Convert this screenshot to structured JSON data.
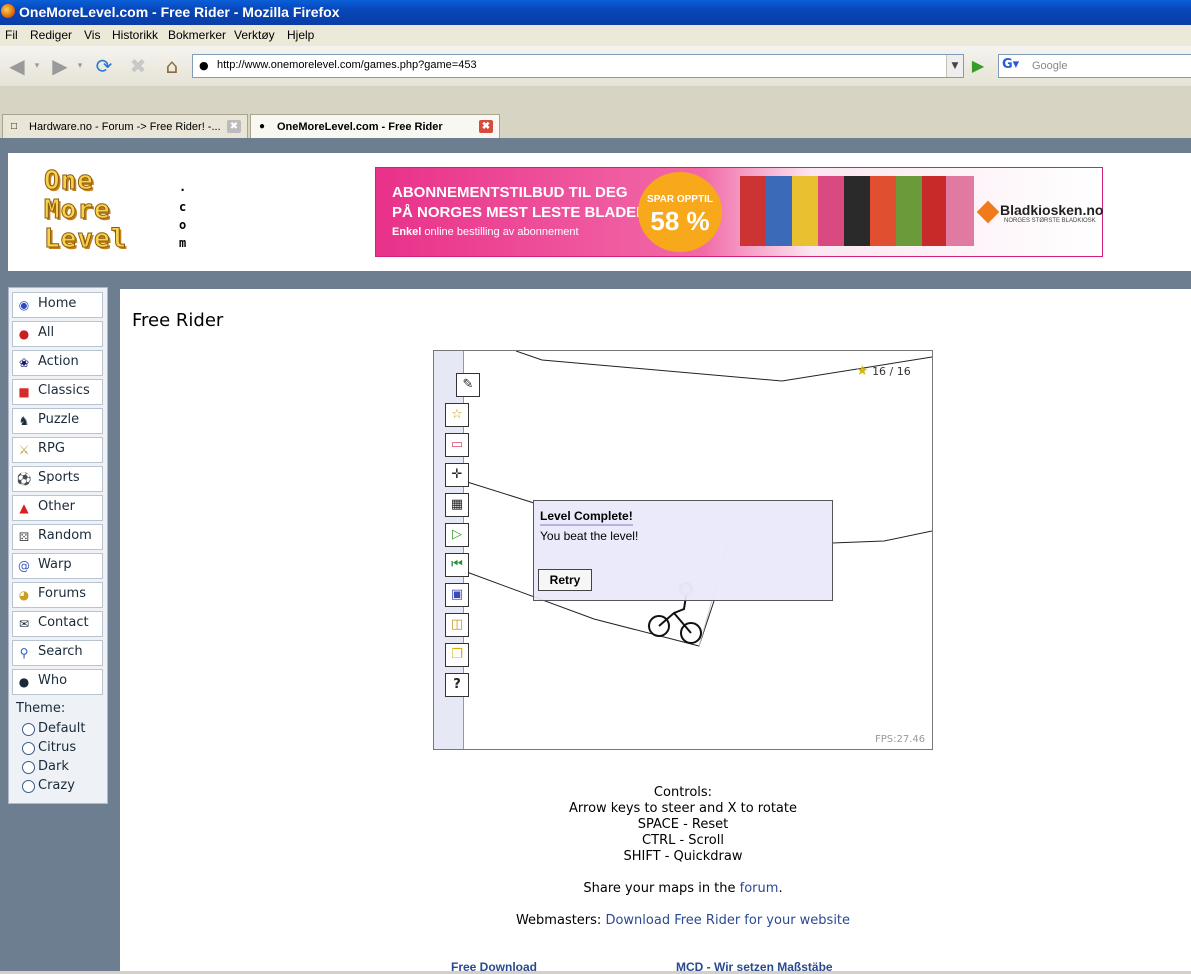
{
  "window": {
    "title": "OneMoreLevel.com - Free Rider - Mozilla Firefox"
  },
  "menu": [
    "Fil",
    "Rediger",
    "Vis",
    "Historikk",
    "Bokmerker",
    "Verktøy",
    "Hjelp"
  ],
  "address": {
    "url": "http://www.onemorelevel.com/games.php?game=453"
  },
  "search": {
    "placeholder": "Google"
  },
  "tabs": [
    {
      "label": "Hardware.no - Forum -> Free Rider! -..."
    },
    {
      "label": "OneMoreLevel.com - Free Rider"
    }
  ],
  "logo": {
    "line1": "One",
    "line2": "More",
    "line3": "Level",
    "com": [
      ".",
      "c",
      "o",
      "m"
    ]
  },
  "ad": {
    "line1": "ABONNEMENTSTILBUD TIL DEG",
    "line2": "PÅ NORGES MEST LESTE BLADER",
    "line3_bold": "Enkel",
    "line3_rest": " online bestilling av abonnement",
    "badge_top": "SPAR OPPTIL",
    "badge_pct": "58 %",
    "brand": "Bladkiosken.no",
    "brand_sub": "NORGES STØRSTE BLADKIOSK"
  },
  "sidebar": {
    "items": [
      {
        "label": "Home",
        "icon": "home-icon"
      },
      {
        "label": "All",
        "icon": "cherries-icon"
      },
      {
        "label": "Action",
        "icon": "runner-icon"
      },
      {
        "label": "Classics",
        "icon": "mario-icon"
      },
      {
        "label": "Puzzle",
        "icon": "chess-knight-icon"
      },
      {
        "label": "RPG",
        "icon": "sword-icon"
      },
      {
        "label": "Sports",
        "icon": "soccer-ball-icon"
      },
      {
        "label": "Other",
        "icon": "ghost-icon"
      },
      {
        "label": "Random",
        "icon": "dice-icon"
      },
      {
        "label": "Warp",
        "icon": "spiral-icon"
      },
      {
        "label": "Forums",
        "icon": "pacman-icon"
      },
      {
        "label": "Contact",
        "icon": "envelope-icon"
      },
      {
        "label": "Search",
        "icon": "magnifier-icon"
      },
      {
        "label": "Who",
        "icon": "person-icon"
      }
    ],
    "theme_label": "Theme:",
    "themes": [
      "Default",
      "Citrus",
      "Dark",
      "Crazy"
    ]
  },
  "main": {
    "title": "Free Rider",
    "game": {
      "stars": "16 / 16",
      "fps": "FPS:27.46",
      "dialog_title": "Level Complete!",
      "dialog_msg": "You beat the level!",
      "retry": "Retry"
    },
    "controls": [
      "Controls:",
      "Arrow keys to steer and X to rotate",
      "SPACE - Reset",
      "CTRL - Scroll",
      "SHIFT - Quickdraw"
    ],
    "share_prefix": "Share your maps in the ",
    "share_link": "forum",
    "share_suffix": ".",
    "webmasters_prefix": "Webmasters: ",
    "webmasters_link": "Download Free Rider for your website",
    "bottom_links": [
      "Free Download",
      "MCD - Wir setzen Maßstäbe"
    ]
  }
}
